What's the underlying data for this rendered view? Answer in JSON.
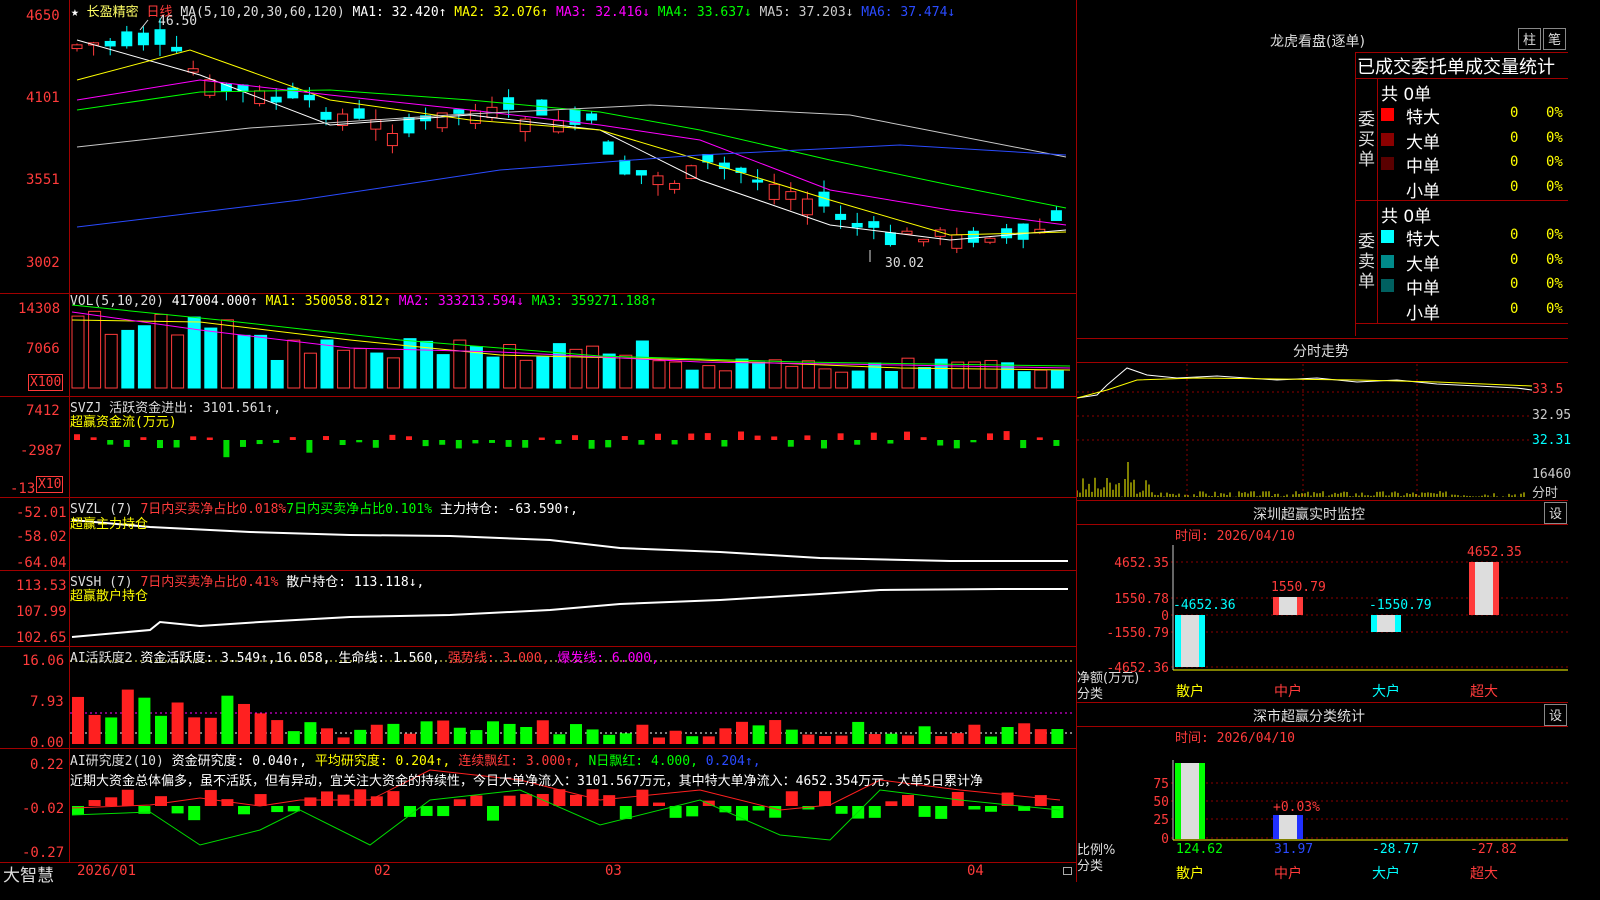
{
  "main": {
    "title": "长盈精密",
    "period": "日线",
    "star": "★",
    "ma_header": "MA(5,10,20,30,60,120)",
    "ma_items": [
      {
        "label": "MA1: 32.420↑",
        "color": "#ffffff"
      },
      {
        "label": "MA2: 32.076↑",
        "color": "#ffff00"
      },
      {
        "label": "MA3: 32.416↓",
        "color": "#ff00ff"
      },
      {
        "label": "MA4: 33.637↓",
        "color": "#00ff00"
      },
      {
        "label": "MA5: 37.203↓",
        "color": "#c8c8c8"
      },
      {
        "label": "MA6: 37.474↓",
        "color": "#2a4bff"
      }
    ],
    "y_ticks": [
      "4650",
      "4101",
      "3551",
      "3002"
    ],
    "high_label": "46.50",
    "low_label": "30.02"
  },
  "vol": {
    "header": "VOL(5,10,20)",
    "value": "417004.000↑",
    "ma1": "MA1: 350058.812↑",
    "ma2": "MA2: 333213.594↓",
    "ma3": "MA3: 359271.188↑",
    "y_ticks": [
      "14308",
      "7066"
    ],
    "unit": "X100"
  },
  "svzj": {
    "header": "SVZJ  活跃资金进出: 3101.561↑,",
    "subtitle": "超赢资金流(万元)",
    "y_ticks": [
      "7412",
      "-2987",
      "-13"
    ],
    "unit": "X10"
  },
  "svzl": {
    "header_a": "SVZL (7)",
    "header_b": "7日内买卖净占比0.018%",
    "header_c": "7日内买卖净占比0.101%",
    "header_d": "主力持仓: -63.590↑,",
    "subtitle": "超赢主力持仓",
    "y_ticks": [
      "-52.01",
      "-58.02",
      "-64.04"
    ]
  },
  "svsh": {
    "header_a": "SVSH (7)",
    "header_b": "7日内买卖净占比0.41%",
    "header_c": "散户持仓: 113.118↓,",
    "subtitle": "超赢散户持仓",
    "y_ticks": [
      "113.53",
      "107.99",
      "102.65"
    ]
  },
  "ai1": {
    "header_a": "AI活跃度2",
    "header_b": "资金活跃度: 3.549↑,16.058,",
    "header_c": "生命线: 1.560,",
    "header_d": "强势线: 3.000,",
    "header_e": "爆发线: 6.000,",
    "y_ticks": [
      "16.06",
      "7.93",
      "0.00"
    ]
  },
  "ai2": {
    "header_a": "AI研究度2(10)",
    "header_b": "资金研究度: 0.040↑,",
    "header_c": "平均研究度: 0.204↑,",
    "header_d": "连续飘红: 3.000↑,",
    "header_e": "N日飘红: 4.000,",
    "header_f": "0.204↑,",
    "comment": "近期大资金总体偏多，虽不活跃，但有异动，宜关注大资金的持续性，今日大单净流入：3101.567万元，其中特大单净流入：4652.354万元，大单5日累计净",
    "y_ticks": [
      "0.22",
      "-0.02",
      "-0.27"
    ]
  },
  "footer": {
    "brand": "大智慧",
    "dates": [
      "2026/01",
      "02",
      "03",
      "04"
    ]
  },
  "dragon": {
    "title": "龙虎看盘(逐单)",
    "btn1": "柱",
    "btn2": "笔",
    "subtitle": "已成交委托单成交量统计",
    "buy_label": "委买单",
    "sell_label": "委卖单",
    "buy_total": "共 0单",
    "sell_total": "共 0单",
    "buy_rows": [
      {
        "name": "特大",
        "count": "0",
        "pct": "0%",
        "color": "#ff0000"
      },
      {
        "name": "大单",
        "count": "0",
        "pct": "0%",
        "color": "#8b0000"
      },
      {
        "name": "中单",
        "count": "0",
        "pct": "0%",
        "color": "#5a0000"
      },
      {
        "name": "小单",
        "count": "0",
        "pct": "0%",
        "color": ""
      }
    ],
    "sell_rows": [
      {
        "name": "特大",
        "count": "0",
        "pct": "0%",
        "color": "#00ffff"
      },
      {
        "name": "大单",
        "count": "0",
        "pct": "0%",
        "color": "#008b8b"
      },
      {
        "name": "中单",
        "count": "0",
        "pct": "0%",
        "color": "#006060"
      },
      {
        "name": "小单",
        "count": "0",
        "pct": "0%",
        "color": ""
      }
    ]
  },
  "intraday": {
    "title": "分时走势",
    "y_ticks": [
      "33.5",
      "32.95",
      "32.31"
    ],
    "vol_label": "16460",
    "time_label": "分时"
  },
  "monitor": {
    "title": "深圳超赢实时监控",
    "btn": "设",
    "time": "时间: 2026/04/10",
    "y_ticks": [
      "4652.35",
      "1550.78",
      "0",
      "-1550.79",
      "-4652.36"
    ],
    "bar_labels": [
      "-4652.36",
      "1550.79",
      "-1550.79",
      "4652.35"
    ],
    "axis_label1": "净额(万元)",
    "axis_label2": "分类",
    "categories": [
      "散户",
      "中户",
      "大户",
      "超大"
    ]
  },
  "classify": {
    "title": "深市超赢分类统计",
    "btn": "设",
    "time": "时间: 2026/04/10",
    "y_ticks": [
      "75",
      "50",
      "25",
      "0"
    ],
    "pct_label": "+0.03%",
    "values": [
      "124.62",
      "31.97",
      "-28.77",
      "-27.82"
    ],
    "axis_label1": "比例%",
    "axis_label2": "分类",
    "categories": [
      "散户",
      "中户",
      "大户",
      "超大"
    ]
  }
}
